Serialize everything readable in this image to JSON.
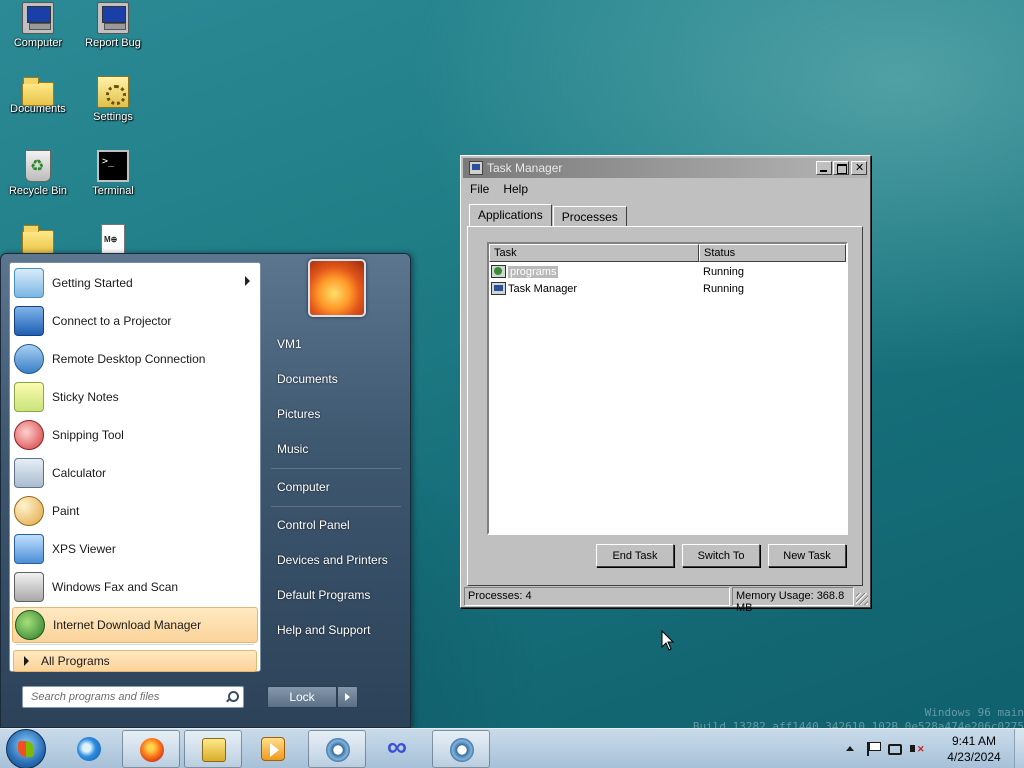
{
  "desktop": {
    "icons": [
      {
        "label": "Computer",
        "icon": "computer-icon"
      },
      {
        "label": "Report Bug",
        "icon": "report-bug-icon"
      },
      {
        "label": "Documents",
        "icon": "documents-folder-icon"
      },
      {
        "label": "Settings",
        "icon": "settings-icon"
      },
      {
        "label": "Recycle Bin",
        "icon": "recycle-bin-icon"
      },
      {
        "label": "Terminal",
        "icon": "terminal-icon"
      },
      {
        "label": "",
        "icon": "folder-icon"
      },
      {
        "label": "",
        "icon": "markdown-file-icon"
      }
    ],
    "watermark": {
      "line1": "Windows 96 main",
      "line2": "Build 13282 aff1440 342610 102B 0e528a474e206c0275"
    }
  },
  "start_menu": {
    "programs": [
      {
        "label": "Getting Started",
        "icon": "getting-started-icon",
        "has_submenu": true
      },
      {
        "label": "Connect to a Projector",
        "icon": "projector-icon"
      },
      {
        "label": "Remote Desktop Connection",
        "icon": "remote-desktop-icon"
      },
      {
        "label": "Sticky Notes",
        "icon": "sticky-notes-icon"
      },
      {
        "label": "Snipping Tool",
        "icon": "snipping-tool-icon"
      },
      {
        "label": "Calculator",
        "icon": "calculator-icon"
      },
      {
        "label": "Paint",
        "icon": "paint-icon"
      },
      {
        "label": "XPS Viewer",
        "icon": "xps-viewer-icon"
      },
      {
        "label": "Windows Fax and Scan",
        "icon": "fax-scan-icon"
      },
      {
        "label": "Internet Download Manager",
        "icon": "idm-icon",
        "highlighted": true
      }
    ],
    "all_programs_label": "All Programs",
    "search_placeholder": "Search programs and files",
    "right_links": [
      "VM1",
      "Documents",
      "Pictures",
      "Music",
      "Computer",
      "Control Panel",
      "Devices and Printers",
      "Default Programs",
      "Help and Support"
    ],
    "lock_label": "Lock"
  },
  "task_manager": {
    "title": "Task Manager",
    "menu": [
      "File",
      "Help"
    ],
    "tabs": [
      "Applications",
      "Processes"
    ],
    "active_tab": "Applications",
    "columns": [
      "Task",
      "Status"
    ],
    "rows": [
      {
        "task": "programs",
        "status": "Running",
        "selected": true
      },
      {
        "task": "Task Manager",
        "status": "Running"
      }
    ],
    "buttons": {
      "end_task": "End Task",
      "switch_to": "Switch To",
      "new_task": "New Task"
    },
    "status": {
      "processes": "Processes: 4",
      "memory": "Memory Usage: 368.8 MB"
    }
  },
  "taskbar": {
    "apps": [
      {
        "name": "internet-explorer-icon"
      },
      {
        "name": "firefox-icon",
        "open": true
      },
      {
        "name": "file-explorer-icon",
        "open": true
      },
      {
        "name": "media-player-icon"
      },
      {
        "name": "app-ring-icon",
        "open": true
      },
      {
        "name": "infinity-app-icon"
      },
      {
        "name": "app-ring-icon-2",
        "open": true
      }
    ],
    "clock": {
      "time": "9:41 AM",
      "date": "4/23/2024"
    }
  }
}
